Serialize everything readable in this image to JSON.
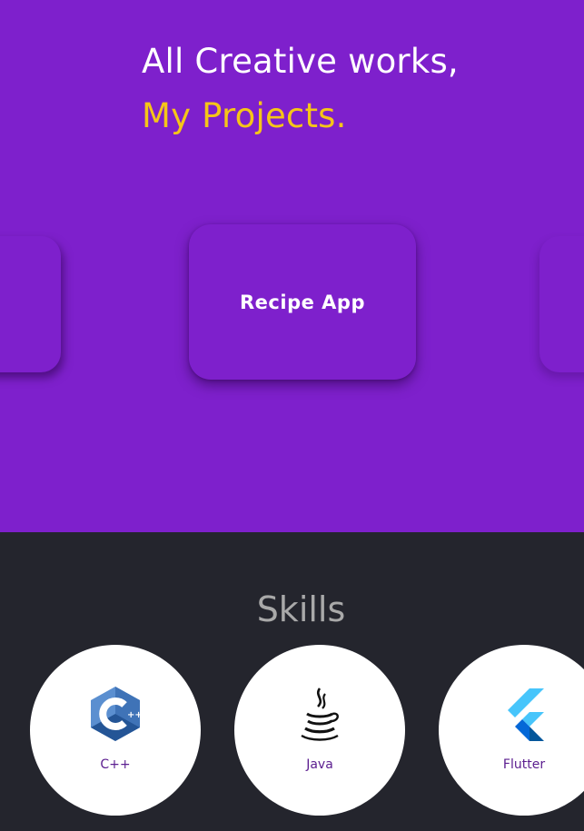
{
  "projects": {
    "heading_line1": "All Creative works,",
    "heading_line2": "My Projects.",
    "card_label": "Recipe App",
    "colors": {
      "background": "#7e20cc",
      "accent": "#f5c518",
      "text": "#ffffff"
    }
  },
  "skills": {
    "title": "Skills",
    "items": [
      {
        "label": "C++",
        "icon": "cpp-logo-icon"
      },
      {
        "label": "Java",
        "icon": "java-logo-icon"
      },
      {
        "label": "Flutter",
        "icon": "flutter-logo-icon"
      }
    ],
    "colors": {
      "background": "#24252d",
      "title": "#a9a9a9",
      "label": "#5b1d8f"
    }
  }
}
